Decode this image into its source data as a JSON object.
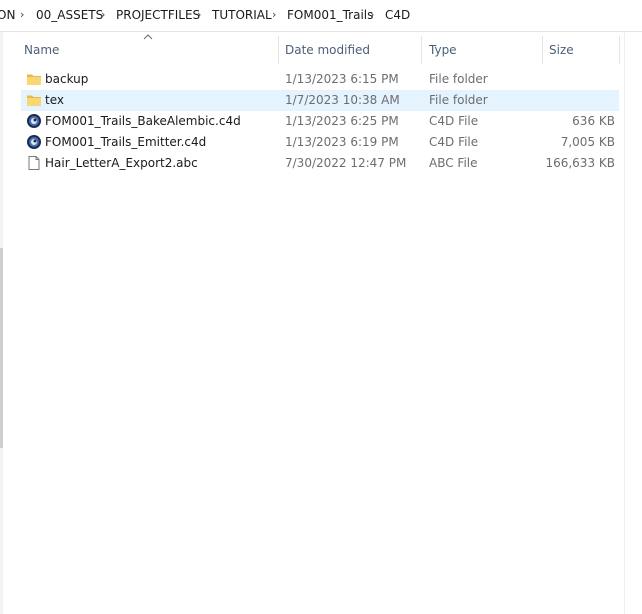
{
  "breadcrumb": {
    "items": [
      "ON",
      "00_ASSETS",
      "PROJECTFILES",
      "TUTORIAL",
      "FOM001_Trails",
      "C4D"
    ],
    "separator": "›"
  },
  "columns": {
    "name": "Name",
    "date_modified": "Date modified",
    "type": "Type",
    "size": "Size"
  },
  "files": [
    {
      "name": "backup",
      "date": "1/13/2023 6:15 PM",
      "type": "File folder",
      "size": "",
      "icon": "folder-icon",
      "selected": false
    },
    {
      "name": "tex",
      "date": "1/7/2023 10:38 AM",
      "type": "File folder",
      "size": "",
      "icon": "folder-icon",
      "selected": true
    },
    {
      "name": "FOM001_Trails_BakeAlembic.c4d",
      "date": "1/13/2023 6:25 PM",
      "type": "C4D File",
      "size": "636 KB",
      "icon": "cinema4d-icon",
      "selected": false
    },
    {
      "name": "FOM001_Trails_Emitter.c4d",
      "date": "1/13/2023 6:19 PM",
      "type": "C4D File",
      "size": "7,005 KB",
      "icon": "cinema4d-icon",
      "selected": false
    },
    {
      "name": "Hair_LetterA_Export2.abc",
      "date": "7/30/2022 12:47 PM",
      "type": "ABC File",
      "size": "166,633 KB",
      "icon": "document-icon",
      "selected": false
    }
  ],
  "colors": {
    "selection": "#e5f3ff",
    "folder": "#f8d775",
    "header_text": "#4c607a"
  }
}
